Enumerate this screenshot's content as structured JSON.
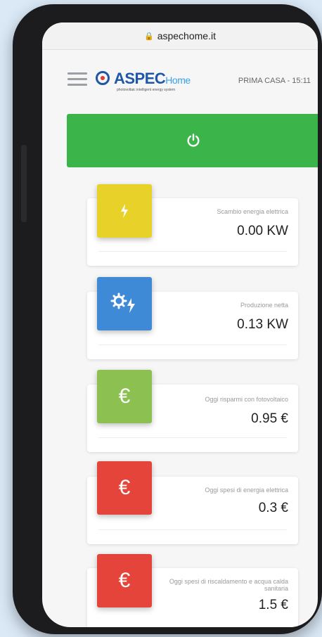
{
  "browser": {
    "url": "aspechome.it"
  },
  "header": {
    "logo_main": "ASPEC",
    "logo_home": "Home",
    "logo_tagline": "photovoltaic intelligent energy system",
    "house_info": "PRIMA CASA - 15:11"
  },
  "colors": {
    "power": "#3bb54a",
    "yellow": "#e8d22a",
    "blue": "#3e8ad6",
    "green": "#8cc152",
    "red": "#e5443a"
  },
  "cards": [
    {
      "label": "Scambio energia elettrica",
      "value": "0.00 KW",
      "icon": "lightning-icon"
    },
    {
      "label": "Produzione netta",
      "value": "0.13 KW",
      "icon": "gear-lightning-icon"
    },
    {
      "label": "Oggi risparmi con fotovoltaico",
      "value": "0.95 €",
      "icon": "euro-icon"
    },
    {
      "label": "Oggi spesi di energia elettrica",
      "value": "0.3 €",
      "icon": "euro-icon"
    },
    {
      "label": "Oggi spesi di riscaldamento e acqua calda sanitaria",
      "value": "1.5 €",
      "icon": "euro-icon"
    }
  ]
}
